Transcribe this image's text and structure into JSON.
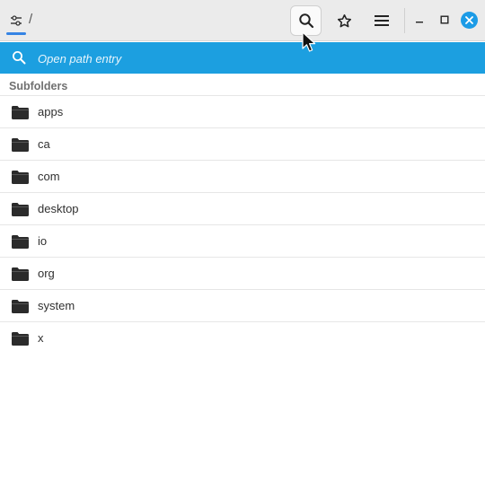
{
  "header": {
    "settings_icon": "sliders-icon",
    "path": "/",
    "search_icon": "search-icon",
    "bookmark_icon": "star-icon",
    "menu_icon": "hamburger-menu-icon",
    "minimize_icon": "minimize-icon",
    "maximize_icon": "maximize-icon",
    "close_icon": "close-icon"
  },
  "path_entry": {
    "placeholder": "Open path entry",
    "value": ""
  },
  "subfolders": {
    "title": "Subfolders",
    "items": [
      {
        "label": "apps"
      },
      {
        "label": "ca"
      },
      {
        "label": "com"
      },
      {
        "label": "desktop"
      },
      {
        "label": "io"
      },
      {
        "label": "org"
      },
      {
        "label": "system"
      },
      {
        "label": "x"
      }
    ]
  },
  "colors": {
    "accent": "#1c9fe0",
    "close_button": "#1c9be6",
    "settings_indicator": "#3584e4",
    "headerbar": "#ebebeb",
    "folder_icon": "#2b2b2b"
  }
}
